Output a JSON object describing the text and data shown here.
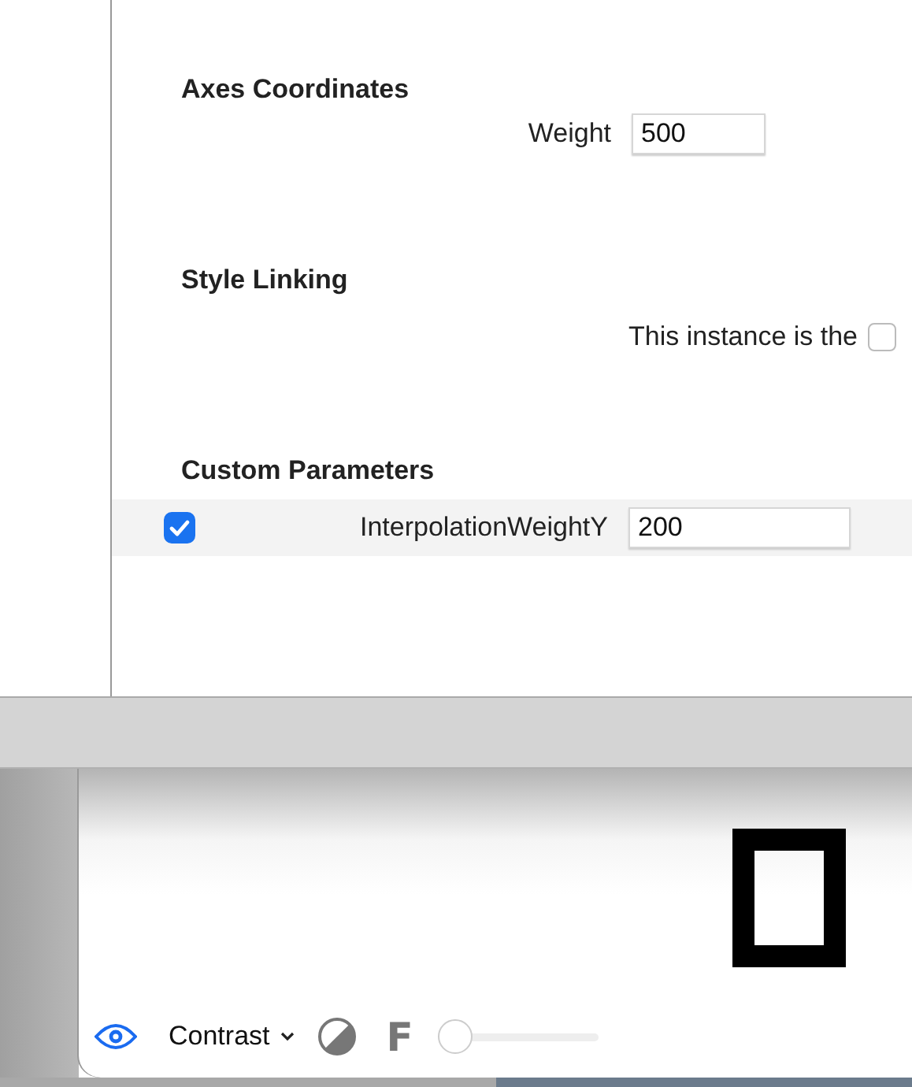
{
  "sections": [
    {
      "kind": "field",
      "title": "Axes Coordinates",
      "label": "Weight",
      "value": "500"
    },
    {
      "kind": "text",
      "title": "Style Linking",
      "text": "This instance is the",
      "checked": false
    },
    {
      "kind": "param",
      "title": "Custom Parameters",
      "checked": true,
      "label": "InterpolationWeightY",
      "value": "200"
    }
  ],
  "preview": {
    "mode": "Contrast",
    "font_letter": "F",
    "slider": {
      "level": 0
    }
  }
}
